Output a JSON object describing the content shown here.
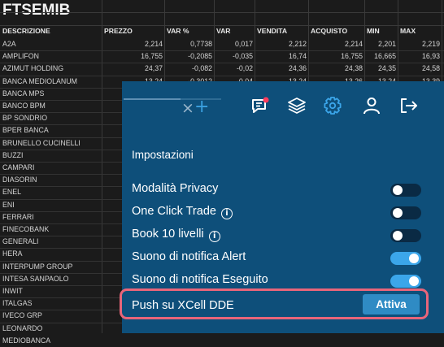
{
  "sheet": {
    "title": "FTSEMIB",
    "columns": [
      "DESCRIZIONE",
      "PREZZO",
      "VAR %",
      "VAR",
      "VENDITA",
      "ACQUISTO",
      "MIN",
      "MAX"
    ],
    "rows": [
      {
        "name": "A2A",
        "values": [
          "2,214",
          "0,7738",
          "0,017",
          "2,212",
          "2,214",
          "2,201",
          "2,219"
        ]
      },
      {
        "name": "AMPLIFON",
        "values": [
          "16,755",
          "-0,2085",
          "-0,035",
          "16,74",
          "16,755",
          "16,665",
          "16,93"
        ]
      },
      {
        "name": "AZIMUT HOLDING",
        "values": [
          "24,37",
          "-0,082",
          "-0,02",
          "24,36",
          "24,38",
          "24,35",
          "24,58"
        ]
      },
      {
        "name": "BANCA MEDIOLANUM",
        "values": [
          "13,24",
          "-0,3012",
          "-0,04",
          "13,24",
          "13,26",
          "13,24",
          "13,39"
        ]
      },
      {
        "name": "BANCA MPS",
        "values": []
      },
      {
        "name": "BANCO BPM",
        "values": []
      },
      {
        "name": "BP SONDRIO",
        "values": []
      },
      {
        "name": "BPER BANCA",
        "values": []
      },
      {
        "name": "BRUNELLO CUCINELLI",
        "values": []
      },
      {
        "name": "BUZZI",
        "values": []
      },
      {
        "name": "CAMPARI",
        "values": []
      },
      {
        "name": "DIASORIN",
        "values": []
      },
      {
        "name": "ENEL",
        "values": []
      },
      {
        "name": "ENI",
        "values": []
      },
      {
        "name": "FERRARI",
        "values": []
      },
      {
        "name": "FINECOBANK",
        "values": []
      },
      {
        "name": "GENERALI",
        "values": []
      },
      {
        "name": "HERA",
        "values": []
      },
      {
        "name": "INTERPUMP GROUP",
        "values": []
      },
      {
        "name": "INTESA SANPAOLO",
        "values": []
      },
      {
        "name": "INWIT",
        "values": []
      },
      {
        "name": "ITALGAS",
        "values": []
      },
      {
        "name": "IVECO GRP",
        "values": []
      },
      {
        "name": "LEONARDO",
        "values": []
      },
      {
        "name": "MEDIOBANCA",
        "values": []
      }
    ]
  },
  "panel": {
    "section_title": "Impostazioni",
    "settings": [
      {
        "label": "Modalità Privacy",
        "info": false,
        "on": false
      },
      {
        "label": "One Click Trade",
        "info": true,
        "on": false
      },
      {
        "label": "Book 10 livelli",
        "info": true,
        "on": false
      },
      {
        "label": "Suono di notifica Alert",
        "info": false,
        "on": true
      },
      {
        "label": "Suono di notifica Eseguito",
        "info": false,
        "on": true
      }
    ],
    "dde_label": "Push su XCell DDE",
    "dde_button": "Attiva",
    "info_glyph": "i",
    "clear_glyph": "×",
    "add_glyph": "+",
    "icons": [
      "chat-notification-icon",
      "layers-icon",
      "gear-icon",
      "user-icon",
      "logout-icon"
    ],
    "colors": {
      "panel_bg": "#0e4f7a",
      "accent": "#3ba6ea",
      "toggle_off": "#0a2a44",
      "highlight": "#e8657a",
      "badge": "#ff3b5c"
    }
  }
}
